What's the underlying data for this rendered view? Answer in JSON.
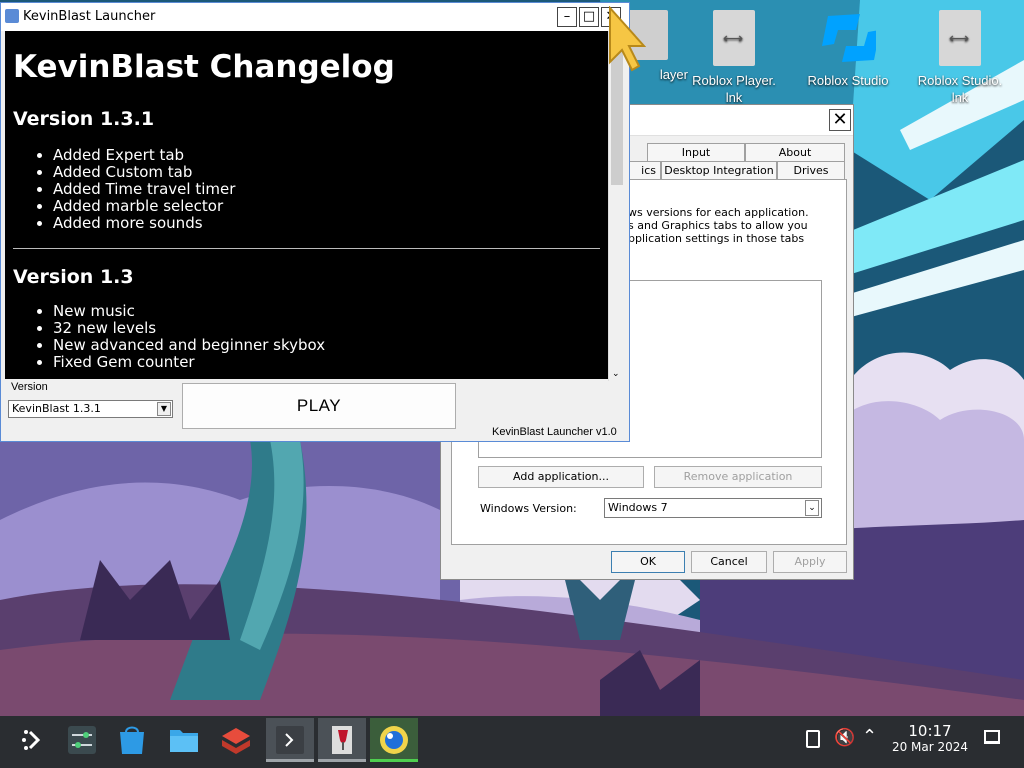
{
  "desktop": {
    "icons": [
      {
        "label": "layer"
      },
      {
        "label": "Roblox Player.\nlnk"
      },
      {
        "label": "Roblox Studio"
      },
      {
        "label": "Roblox Studio.\nlnk"
      }
    ]
  },
  "winecfg": {
    "tabs_row1": [
      "Input",
      "About"
    ],
    "tabs_row2": [
      "ics",
      "Desktop Integration",
      "Drives"
    ],
    "description": "ws versions for each application.\ns and Graphics tabs to allow you\npplication settings in those tabs",
    "add_application": "Add application...",
    "remove_application": "Remove application",
    "windows_version_label": "Windows Version:",
    "windows_version_value": "Windows 7",
    "ok": "OK",
    "cancel": "Cancel",
    "apply": "Apply",
    "close_glyph": "✕"
  },
  "launcher": {
    "title": "KevinBlast Launcher",
    "changelog_title": "KevinBlast Changelog",
    "versions": [
      {
        "name": "Version 1.3.1",
        "items": [
          "Added Expert tab",
          "Added Custom tab",
          "Added Time travel timer",
          "Added marble selector",
          "Added more sounds"
        ]
      },
      {
        "name": "Version 1.3",
        "items": [
          "New music",
          "32 new levels",
          "New advanced and beginner skybox",
          "Fixed Gem counter"
        ]
      }
    ],
    "version_label": "Version",
    "version_selected": "KevinBlast 1.3.1",
    "play_label": "PLAY",
    "footer": "KevinBlast Launcher v1.0"
  },
  "taskbar": {
    "time": "10:17",
    "date": "20 Mar 2024"
  },
  "colors": {
    "sky": "#1d5c7a",
    "taskbar": "#2a2d31",
    "accent_cyan": "#3fd6f0"
  }
}
